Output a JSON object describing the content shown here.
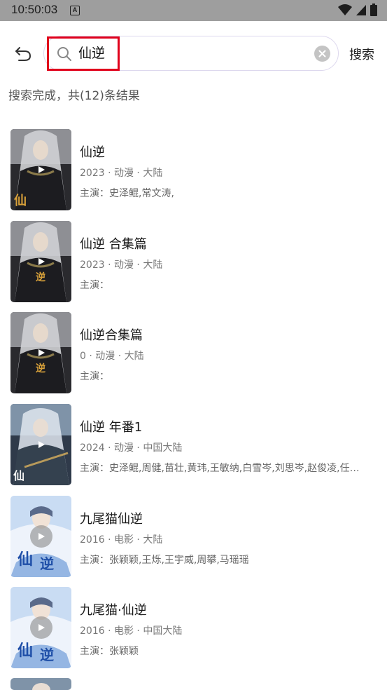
{
  "status_bar": {
    "time": "10:50:03",
    "notification_icon": "A"
  },
  "header": {
    "search_value": "仙逆",
    "search_button_label": "搜索"
  },
  "result_summary": "搜索完成，共(12)条结果",
  "results": [
    {
      "title": "仙逆",
      "meta": "2023 · 动漫 · 大陆",
      "cast": "主演：史泽鲲,常文涛,",
      "poster_theme": "dark"
    },
    {
      "title": "仙逆 合集篇",
      "meta": "2023 · 动漫 · 大陆",
      "cast": "主演：",
      "poster_theme": "dark"
    },
    {
      "title": "仙逆合集篇",
      "meta": "0 · 动漫 · 大陆",
      "cast": "主演：",
      "poster_theme": "dark"
    },
    {
      "title": "仙逆 年番1",
      "meta": "2024 · 动漫 · 中国大陆",
      "cast": "主演：史泽鲲,周健,苗壮,黄玮,王敏纳,白雪岑,刘思岑,赵俊凌,任…",
      "poster_theme": "blue-dark"
    },
    {
      "title": "九尾猫仙逆",
      "meta": "2016 · 电影 · 大陆",
      "cast": "主演：张颖颖,王烁,王宇威,周攀,马瑶瑶",
      "poster_theme": "light-blue"
    },
    {
      "title": "九尾猫·仙逆",
      "meta": "2016 · 电影 · 中国大陆",
      "cast": "主演：张颖颖",
      "poster_theme": "light-blue"
    }
  ],
  "colors": {
    "status_bar": "#9e9e9e",
    "highlight_border": "#e0001b",
    "search_border": "#ddd8ee",
    "meta_text": "#777777"
  }
}
